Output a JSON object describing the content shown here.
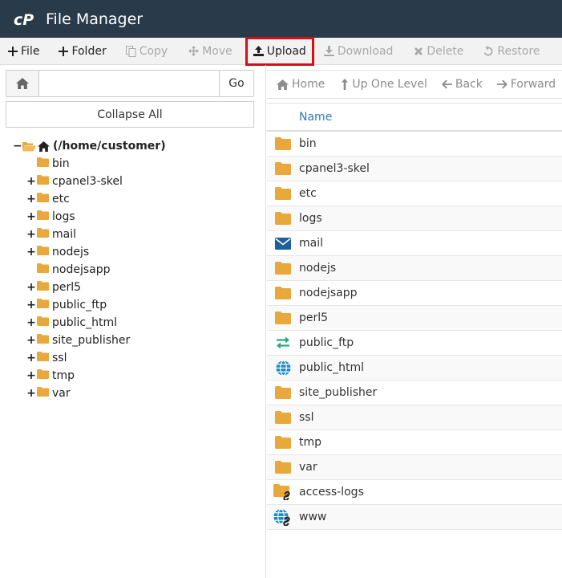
{
  "header": {
    "title": "File Manager",
    "logo": "cP"
  },
  "toolbar": {
    "file_label": "File",
    "folder_label": "Folder",
    "copy_label": "Copy",
    "move_label": "Move",
    "upload_label": "Upload",
    "download_label": "Download",
    "delete_label": "Delete",
    "restore_label": "Restore"
  },
  "sidebar": {
    "path_value": "",
    "go_label": "Go",
    "collapse_label": "Collapse All",
    "root_label": "(/home/customer)",
    "items": [
      {
        "label": "bin",
        "expandable": false
      },
      {
        "label": "cpanel3-skel",
        "expandable": true
      },
      {
        "label": "etc",
        "expandable": true
      },
      {
        "label": "logs",
        "expandable": true
      },
      {
        "label": "mail",
        "expandable": true
      },
      {
        "label": "nodejs",
        "expandable": true
      },
      {
        "label": "nodejsapp",
        "expandable": false
      },
      {
        "label": "perl5",
        "expandable": true
      },
      {
        "label": "public_ftp",
        "expandable": true
      },
      {
        "label": "public_html",
        "expandable": true
      },
      {
        "label": "site_publisher",
        "expandable": true
      },
      {
        "label": "ssl",
        "expandable": true
      },
      {
        "label": "tmp",
        "expandable": true
      },
      {
        "label": "var",
        "expandable": true
      }
    ]
  },
  "nav": {
    "home_label": "Home",
    "up_label": "Up One Level",
    "back_label": "Back",
    "forward_label": "Forward"
  },
  "table": {
    "name_header": "Name",
    "rows": [
      {
        "name": "bin",
        "icon": "folder-icon"
      },
      {
        "name": "cpanel3-skel",
        "icon": "folder-icon"
      },
      {
        "name": "etc",
        "icon": "folder-icon"
      },
      {
        "name": "logs",
        "icon": "folder-icon"
      },
      {
        "name": "mail",
        "icon": "mail-icon"
      },
      {
        "name": "nodejs",
        "icon": "folder-icon"
      },
      {
        "name": "nodejsapp",
        "icon": "folder-icon"
      },
      {
        "name": "perl5",
        "icon": "folder-icon"
      },
      {
        "name": "public_ftp",
        "icon": "transfer-icon"
      },
      {
        "name": "public_html",
        "icon": "globe-icon"
      },
      {
        "name": "site_publisher",
        "icon": "folder-icon"
      },
      {
        "name": "ssl",
        "icon": "folder-icon"
      },
      {
        "name": "tmp",
        "icon": "folder-icon"
      },
      {
        "name": "var",
        "icon": "folder-icon"
      },
      {
        "name": "access-logs",
        "icon": "folder-link-icon"
      },
      {
        "name": "www",
        "icon": "globe-link-icon"
      }
    ]
  },
  "colors": {
    "header_bg": "#293a4a",
    "folder": "#e8a83c",
    "link_blue": "#337ab7",
    "highlight_red": "#d0101a",
    "mail_blue": "#1f5f9e",
    "transfer_green": "#2aa87c",
    "globe_blue": "#1e88c7"
  }
}
